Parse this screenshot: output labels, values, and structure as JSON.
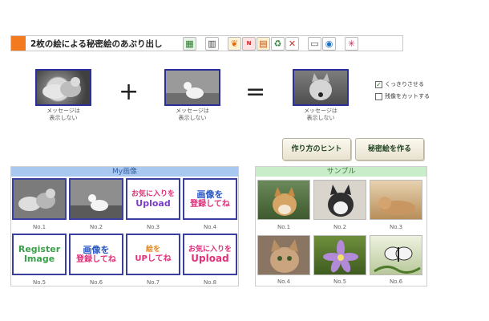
{
  "header": {
    "title": "2枚の絵による秘密絵のあぶり出し",
    "toolbar_icons": [
      "calendar-icon",
      "film-icon",
      "bird-icon",
      "new-icon",
      "cards-icon",
      "recycle-icon",
      "toys-icon",
      "print-icon",
      "magnifier-icon",
      "star-icon"
    ]
  },
  "compose": {
    "left_caption": "メッセージは\n表示しない",
    "middle_caption": "メッセージは\n表示しない",
    "right_caption": "メッセージは\n表示しない",
    "plus": "+",
    "equals": "=",
    "option_sharpen": "くっきりさせる",
    "option_cut": "残像をカットする",
    "hint_button": "作り方のヒント",
    "make_button": "秘密絵を作る"
  },
  "my_images": {
    "title": "My画像",
    "labels": [
      "No.1",
      "No.2",
      "No.3",
      "No.4",
      "No.5",
      "No.6",
      "No.7",
      "No.8"
    ],
    "promos": {
      "fav_upload_top": "お気に入りを",
      "fav_upload_bottom": "Upload",
      "register_top": "画像を",
      "register_bottom": "登録してね",
      "register_en_top": "Register",
      "register_en_bottom": "Image",
      "up_top": "絵を",
      "up_bottom": "UPしてね"
    }
  },
  "samples": {
    "title": "サンプル",
    "labels": [
      "No.1",
      "No.2",
      "No.3",
      "No.4",
      "No.5",
      "No.6"
    ]
  },
  "colors": {
    "accent": "#f47a20",
    "thumb_border": "#2a2f9a",
    "my_header": "#a8c8f0",
    "sample_header": "#c9edc9"
  }
}
